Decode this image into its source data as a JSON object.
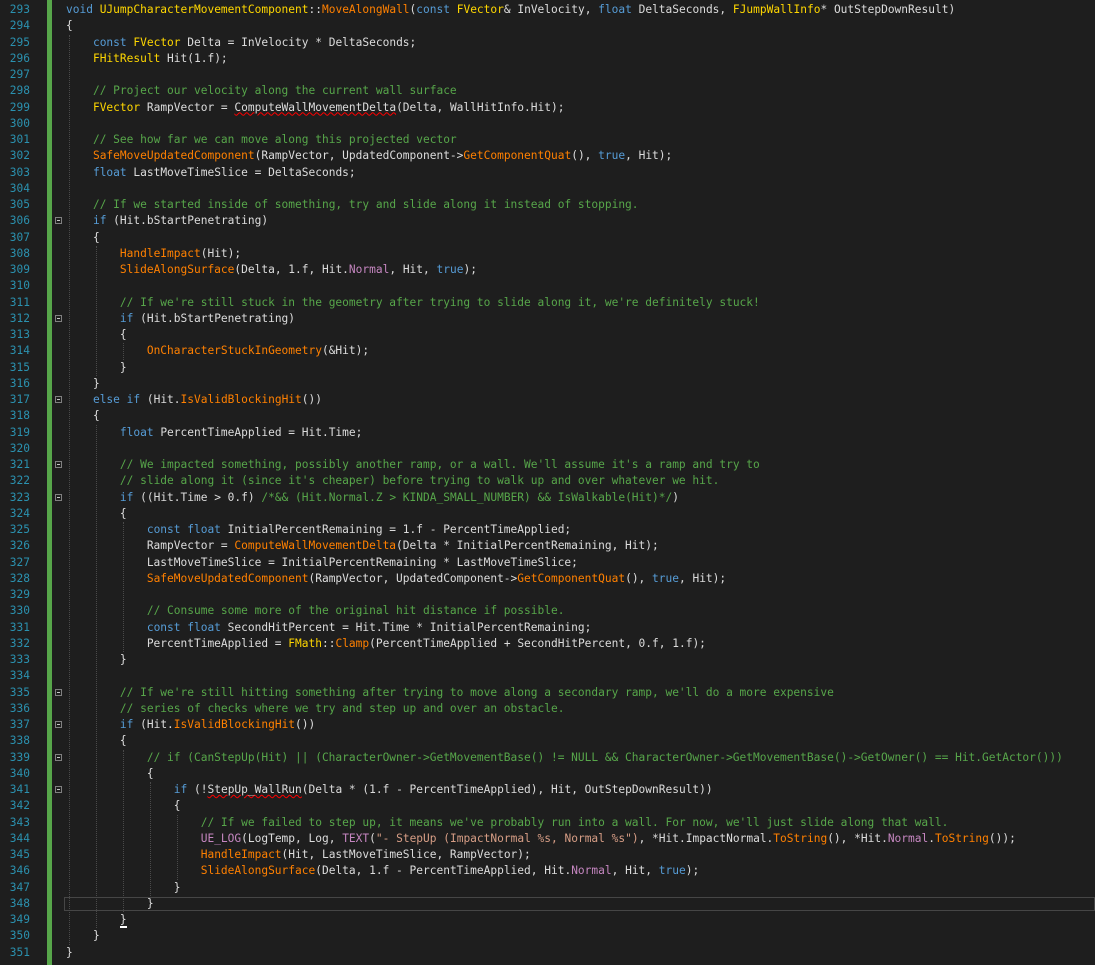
{
  "editor": {
    "lines": [
      {
        "n": "293",
        "fold": false,
        "parts": [
          [
            "kw",
            "void "
          ],
          [
            "ty2",
            "UJumpCharacterMovementComponent"
          ],
          [
            "",
            "::"
          ],
          [
            "fn",
            "MoveAlongWall"
          ],
          [
            "",
            "("
          ],
          [
            "kw",
            "const "
          ],
          [
            "ty2",
            "FVector"
          ],
          [
            "",
            "& InVelocity, "
          ],
          [
            "kw",
            "float"
          ],
          [
            "",
            " DeltaSeconds, "
          ],
          [
            "ty2",
            "FJumpWallInfo"
          ],
          [
            "",
            "* OutStepDownResult)"
          ]
        ]
      },
      {
        "n": "294",
        "fold": false,
        "parts": [
          [
            "",
            "{"
          ]
        ]
      },
      {
        "n": "295",
        "fold": false,
        "parts": [
          [
            "",
            "    "
          ],
          [
            "kw",
            "const "
          ],
          [
            "ty2",
            "FVector"
          ],
          [
            "",
            " Delta = InVelocity * DeltaSeconds;"
          ]
        ]
      },
      {
        "n": "296",
        "fold": false,
        "parts": [
          [
            "",
            "    "
          ],
          [
            "ty2",
            "FHitResult"
          ],
          [
            "",
            " Hit(1.f);"
          ]
        ]
      },
      {
        "n": "297",
        "fold": false,
        "parts": [
          [
            "",
            ""
          ]
        ]
      },
      {
        "n": "298",
        "fold": false,
        "parts": [
          [
            "",
            "    "
          ],
          [
            "cm",
            "// Project our velocity along the current wall surface"
          ]
        ]
      },
      {
        "n": "299",
        "fold": false,
        "parts": [
          [
            "",
            "    "
          ],
          [
            "ty2",
            "FVector"
          ],
          [
            "",
            " RampVector = "
          ],
          [
            "sq",
            "ComputeWallMovementDelta"
          ],
          [
            "",
            "(Delta, WallHitInfo.Hit);"
          ]
        ]
      },
      {
        "n": "300",
        "fold": false,
        "parts": [
          [
            "",
            ""
          ]
        ]
      },
      {
        "n": "301",
        "fold": false,
        "parts": [
          [
            "",
            "    "
          ],
          [
            "cm",
            "// See how far we can move along this projected vector"
          ]
        ]
      },
      {
        "n": "302",
        "fold": false,
        "parts": [
          [
            "",
            "    "
          ],
          [
            "fn",
            "SafeMoveUpdatedComponent"
          ],
          [
            "",
            "(RampVector, UpdatedComponent->"
          ],
          [
            "fn",
            "GetComponentQuat"
          ],
          [
            "",
            "(), "
          ],
          [
            "kw",
            "true"
          ],
          [
            "",
            ", Hit);"
          ]
        ]
      },
      {
        "n": "303",
        "fold": false,
        "parts": [
          [
            "",
            "    "
          ],
          [
            "kw",
            "float"
          ],
          [
            "",
            " LastMoveTimeSlice = DeltaSeconds;"
          ]
        ]
      },
      {
        "n": "304",
        "fold": false,
        "parts": [
          [
            "",
            ""
          ]
        ]
      },
      {
        "n": "305",
        "fold": false,
        "parts": [
          [
            "",
            "    "
          ],
          [
            "cm",
            "// If we started inside of something, try and slide along it instead of stopping."
          ]
        ]
      },
      {
        "n": "306",
        "fold": true,
        "parts": [
          [
            "",
            "    "
          ],
          [
            "kw",
            "if"
          ],
          [
            "",
            " (Hit.bStartPenetrating)"
          ]
        ]
      },
      {
        "n": "307",
        "fold": false,
        "parts": [
          [
            "",
            "    {"
          ]
        ]
      },
      {
        "n": "308",
        "fold": false,
        "parts": [
          [
            "",
            "        "
          ],
          [
            "fn",
            "HandleImpact"
          ],
          [
            "",
            "(Hit);"
          ]
        ]
      },
      {
        "n": "309",
        "fold": false,
        "parts": [
          [
            "",
            "        "
          ],
          [
            "fn",
            "SlideAlongSurface"
          ],
          [
            "",
            "(Delta, 1.f, Hit."
          ],
          [
            "mem",
            "Normal"
          ],
          [
            "",
            ", Hit, "
          ],
          [
            "kw",
            "true"
          ],
          [
            "",
            ");"
          ]
        ]
      },
      {
        "n": "310",
        "fold": false,
        "parts": [
          [
            "",
            ""
          ]
        ]
      },
      {
        "n": "311",
        "fold": false,
        "parts": [
          [
            "",
            "        "
          ],
          [
            "cm",
            "// If we're still stuck in the geometry after trying to slide along it, we're definitely stuck!"
          ]
        ]
      },
      {
        "n": "312",
        "fold": true,
        "parts": [
          [
            "",
            "        "
          ],
          [
            "kw",
            "if"
          ],
          [
            "",
            " (Hit.bStartPenetrating)"
          ]
        ]
      },
      {
        "n": "313",
        "fold": false,
        "parts": [
          [
            "",
            "        {"
          ]
        ]
      },
      {
        "n": "314",
        "fold": false,
        "parts": [
          [
            "",
            "            "
          ],
          [
            "fn",
            "OnCharacterStuckInGeometry"
          ],
          [
            "",
            "(&Hit);"
          ]
        ]
      },
      {
        "n": "315",
        "fold": false,
        "parts": [
          [
            "",
            "        }"
          ]
        ]
      },
      {
        "n": "316",
        "fold": false,
        "parts": [
          [
            "",
            "    }"
          ]
        ]
      },
      {
        "n": "317",
        "fold": true,
        "parts": [
          [
            "",
            "    "
          ],
          [
            "kw",
            "else if"
          ],
          [
            "",
            " (Hit."
          ],
          [
            "fn",
            "IsValidBlockingHit"
          ],
          [
            "",
            "())"
          ]
        ]
      },
      {
        "n": "318",
        "fold": false,
        "parts": [
          [
            "",
            "    {"
          ]
        ]
      },
      {
        "n": "319",
        "fold": false,
        "parts": [
          [
            "",
            "        "
          ],
          [
            "kw",
            "float"
          ],
          [
            "",
            " PercentTimeApplied = Hit.Time;"
          ]
        ]
      },
      {
        "n": "320",
        "fold": false,
        "parts": [
          [
            "",
            ""
          ]
        ]
      },
      {
        "n": "321",
        "fold": true,
        "parts": [
          [
            "",
            "        "
          ],
          [
            "cm",
            "// We impacted something, possibly another ramp, or a wall. We'll assume it's a ramp and try to"
          ]
        ]
      },
      {
        "n": "322",
        "fold": false,
        "parts": [
          [
            "",
            "        "
          ],
          [
            "cm",
            "// slide along it (since it's cheaper) before trying to walk up and over whatever we hit."
          ]
        ]
      },
      {
        "n": "323",
        "fold": true,
        "parts": [
          [
            "",
            "        "
          ],
          [
            "kw",
            "if"
          ],
          [
            "",
            " ((Hit.Time > 0.f) "
          ],
          [
            "cm",
            "/*&& (Hit.Normal.Z > KINDA_SMALL_NUMBER) && IsWalkable(Hit)*/"
          ],
          [
            "",
            ")"
          ]
        ]
      },
      {
        "n": "324",
        "fold": false,
        "parts": [
          [
            "",
            "        {"
          ]
        ]
      },
      {
        "n": "325",
        "fold": false,
        "parts": [
          [
            "",
            "            "
          ],
          [
            "kw",
            "const float"
          ],
          [
            "",
            " InitialPercentRemaining = 1.f - PercentTimeApplied;"
          ]
        ]
      },
      {
        "n": "326",
        "fold": false,
        "parts": [
          [
            "",
            "            RampVector = "
          ],
          [
            "fn",
            "ComputeWallMovementDelta"
          ],
          [
            "",
            "(Delta * InitialPercentRemaining, Hit);"
          ]
        ]
      },
      {
        "n": "327",
        "fold": false,
        "parts": [
          [
            "",
            "            LastMoveTimeSlice = InitialPercentRemaining * LastMoveTimeSlice;"
          ]
        ]
      },
      {
        "n": "328",
        "fold": false,
        "parts": [
          [
            "",
            "            "
          ],
          [
            "fn",
            "SafeMoveUpdatedComponent"
          ],
          [
            "",
            "(RampVector, UpdatedComponent->"
          ],
          [
            "fn",
            "GetComponentQuat"
          ],
          [
            "",
            "(), "
          ],
          [
            "kw",
            "true"
          ],
          [
            "",
            ", Hit);"
          ]
        ]
      },
      {
        "n": "329",
        "fold": false,
        "parts": [
          [
            "",
            ""
          ]
        ]
      },
      {
        "n": "330",
        "fold": false,
        "parts": [
          [
            "",
            "            "
          ],
          [
            "cm",
            "// Consume some more of the original hit distance if possible."
          ]
        ]
      },
      {
        "n": "331",
        "fold": false,
        "parts": [
          [
            "",
            "            "
          ],
          [
            "kw",
            "const float"
          ],
          [
            "",
            " SecondHitPercent = Hit.Time * InitialPercentRemaining;"
          ]
        ]
      },
      {
        "n": "332",
        "fold": false,
        "parts": [
          [
            "",
            "            PercentTimeApplied = "
          ],
          [
            "ty2",
            "FMath"
          ],
          [
            "",
            "::"
          ],
          [
            "fn",
            "Clamp"
          ],
          [
            "",
            "(PercentTimeApplied + SecondHitPercent, 0.f, 1.f);"
          ]
        ]
      },
      {
        "n": "333",
        "fold": false,
        "parts": [
          [
            "",
            "        }"
          ]
        ]
      },
      {
        "n": "334",
        "fold": false,
        "parts": [
          [
            "",
            ""
          ]
        ]
      },
      {
        "n": "335",
        "fold": true,
        "parts": [
          [
            "",
            "        "
          ],
          [
            "cm",
            "// If we're still hitting something after trying to move along a secondary ramp, we'll do a more expensive"
          ]
        ]
      },
      {
        "n": "336",
        "fold": false,
        "parts": [
          [
            "",
            "        "
          ],
          [
            "cm",
            "// series of checks where we try and step up and over an obstacle."
          ]
        ]
      },
      {
        "n": "337",
        "fold": true,
        "parts": [
          [
            "",
            "        "
          ],
          [
            "kw",
            "if"
          ],
          [
            "",
            " (Hit."
          ],
          [
            "fn",
            "IsValidBlockingHit"
          ],
          [
            "",
            "())"
          ]
        ]
      },
      {
        "n": "338",
        "fold": false,
        "parts": [
          [
            "",
            "        {"
          ]
        ]
      },
      {
        "n": "339",
        "fold": true,
        "parts": [
          [
            "",
            "            "
          ],
          [
            "cm",
            "// if (CanStepUp(Hit) || (CharacterOwner->GetMovementBase() != NULL && CharacterOwner->GetMovementBase()->GetOwner() == Hit.GetActor()))"
          ]
        ]
      },
      {
        "n": "340",
        "fold": false,
        "parts": [
          [
            "",
            "            {"
          ]
        ]
      },
      {
        "n": "341",
        "fold": true,
        "parts": [
          [
            "",
            "                "
          ],
          [
            "kw",
            "if"
          ],
          [
            "",
            " (!"
          ],
          [
            "sq",
            "StepUp_WallRun"
          ],
          [
            "",
            "(Delta * (1.f - PercentTimeApplied), Hit, OutStepDownResult))"
          ]
        ]
      },
      {
        "n": "342",
        "fold": false,
        "parts": [
          [
            "",
            "                {"
          ]
        ]
      },
      {
        "n": "343",
        "fold": false,
        "parts": [
          [
            "",
            "                    "
          ],
          [
            "cm",
            "// If we failed to step up, it means we've probably run into a wall. For now, we'll just slide along that wall."
          ]
        ]
      },
      {
        "n": "344",
        "fold": false,
        "parts": [
          [
            "",
            "                    "
          ],
          [
            "mem",
            "UE_LOG"
          ],
          [
            "",
            "(LogTemp, Log, "
          ],
          [
            "mem",
            "TEXT"
          ],
          [
            "",
            "("
          ],
          [
            "str",
            "\"- StepUp (ImpactNormal %s, Normal %s\")"
          ],
          [
            "",
            ", *Hit.ImpactNormal."
          ],
          [
            "fn",
            "ToString"
          ],
          [
            "",
            "(), *Hit."
          ],
          [
            "mem",
            "Normal"
          ],
          [
            "",
            "."
          ],
          [
            "fn",
            "ToString"
          ],
          [
            "",
            "());"
          ]
        ]
      },
      {
        "n": "345",
        "fold": false,
        "parts": [
          [
            "",
            "                    "
          ],
          [
            "fn",
            "HandleImpact"
          ],
          [
            "",
            "(Hit, LastMoveTimeSlice, RampVector);"
          ]
        ]
      },
      {
        "n": "346",
        "fold": false,
        "parts": [
          [
            "",
            "                    "
          ],
          [
            "fn",
            "SlideAlongSurface"
          ],
          [
            "",
            "(Delta, 1.f - PercentTimeApplied, Hit."
          ],
          [
            "mem",
            "Normal"
          ],
          [
            "",
            ", Hit, "
          ],
          [
            "kw",
            "true"
          ],
          [
            "",
            ");"
          ]
        ]
      },
      {
        "n": "347",
        "fold": false,
        "parts": [
          [
            "",
            "                }"
          ]
        ]
      },
      {
        "n": "348",
        "fold": false,
        "parts": [
          [
            "",
            "            }"
          ]
        ]
      },
      {
        "n": "349",
        "fold": false,
        "parts": [
          [
            "",
            "        "
          ],
          [
            "caret",
            "}"
          ]
        ]
      },
      {
        "n": "350",
        "fold": false,
        "parts": [
          [
            "",
            "    }"
          ]
        ]
      },
      {
        "n": "351",
        "fold": false,
        "parts": [
          [
            "",
            "}"
          ]
        ]
      }
    ],
    "current_line": "348"
  }
}
